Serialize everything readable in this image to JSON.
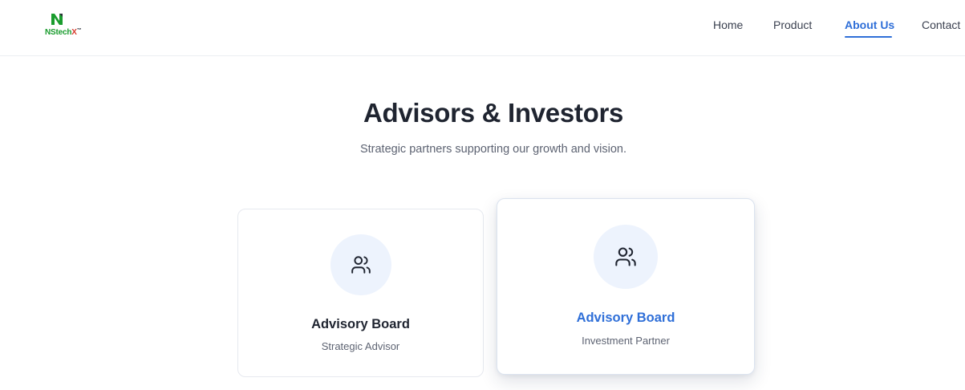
{
  "brand": {
    "logo_letter": "N",
    "name_prefix": "NStech",
    "name_suffix": "X",
    "trademark": "™",
    "colors": {
      "green": "#1a9c2e",
      "red": "#d63a2c"
    }
  },
  "nav": {
    "items": [
      {
        "label": "Home",
        "active": false
      },
      {
        "label": "Product",
        "active": false
      },
      {
        "label": "About Us",
        "active": true
      },
      {
        "label": "Contact",
        "active": false
      }
    ]
  },
  "section": {
    "title": "Advisors & Investors",
    "subtitle": "Strategic partners supporting our growth and vision."
  },
  "cards": [
    {
      "icon": "users-icon",
      "title": "Advisory Board",
      "role": "Strategic Advisor",
      "highlighted": false
    },
    {
      "icon": "users-icon",
      "title": "Advisory Board",
      "role": "Investment Partner",
      "highlighted": true
    }
  ],
  "theme": {
    "accent": "#2f6fd8",
    "icon_bg": "#edf3fd",
    "text_dark": "#1f2430",
    "text_muted": "#5d6372"
  }
}
